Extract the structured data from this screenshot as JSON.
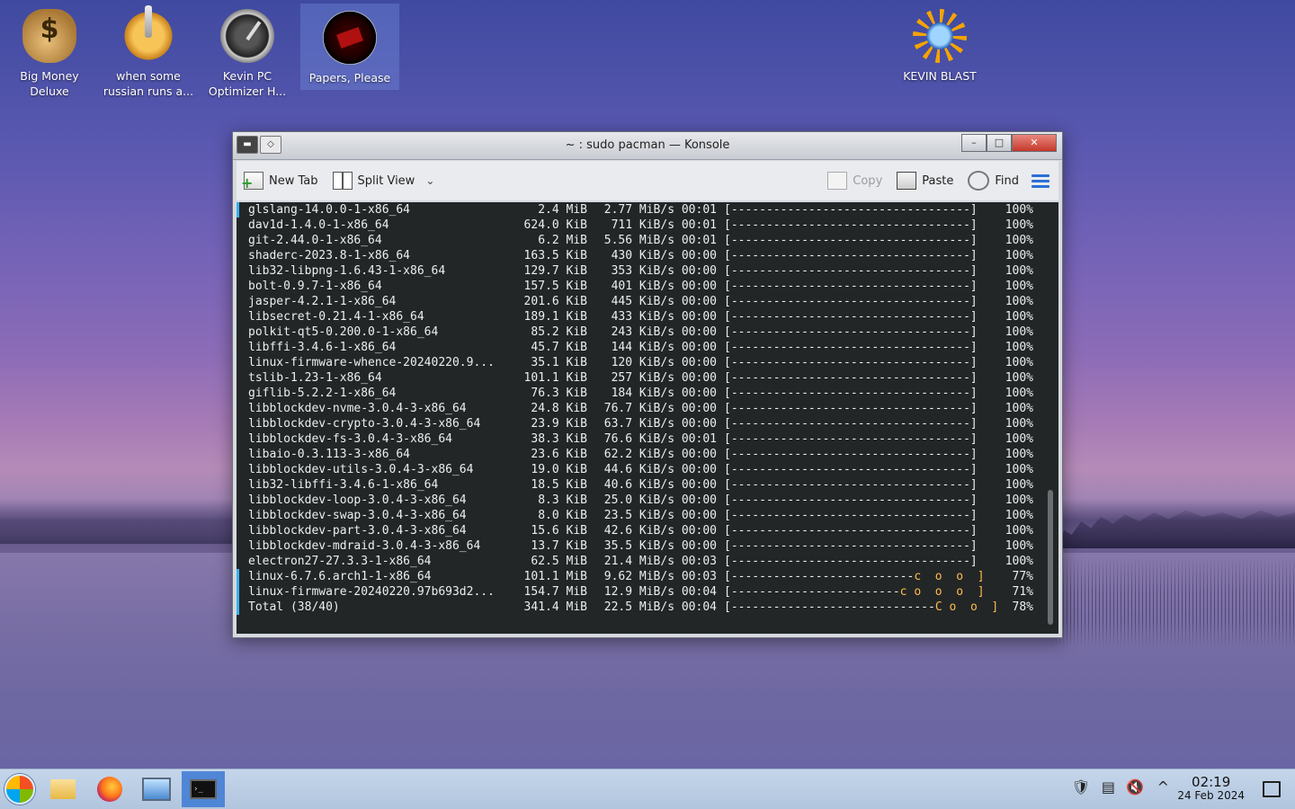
{
  "desktop": {
    "icons": [
      {
        "label1": "Big Money",
        "label2": "Deluxe",
        "icon": "money-bag-icon"
      },
      {
        "label1": "when some",
        "label2": "russian runs a...",
        "icon": "gear-icon"
      },
      {
        "label1": "Kevin PC",
        "label2": "Optimizer H...",
        "icon": "gauge-icon"
      },
      {
        "label1": "Papers, Please",
        "label2": "",
        "icon": "papers-please-icon"
      },
      {
        "label1": "KEVIN BLAST",
        "label2": "",
        "icon": "sun-icon"
      }
    ]
  },
  "window": {
    "title": "~ : sudo pacman — Konsole",
    "toolbar": {
      "new_tab": "New Tab",
      "split_view": "Split View",
      "copy": "Copy",
      "paste": "Paste",
      "find": "Find"
    }
  },
  "terminal": {
    "rows": [
      {
        "name": "glslang-14.0.0-1-x86_64",
        "size": "2.4 MiB",
        "speed": "2.77 MiB/s 00:01",
        "bar": "[----------------------------------]",
        "pac": "",
        "pct": "100%"
      },
      {
        "name": "dav1d-1.4.0-1-x86_64",
        "size": "624.0 KiB",
        "speed": "711 KiB/s 00:01",
        "bar": "[----------------------------------]",
        "pac": "",
        "pct": "100%"
      },
      {
        "name": "git-2.44.0-1-x86_64",
        "size": "6.2 MiB",
        "speed": "5.56 MiB/s 00:01",
        "bar": "[----------------------------------]",
        "pac": "",
        "pct": "100%"
      },
      {
        "name": "shaderc-2023.8-1-x86_64",
        "size": "163.5 KiB",
        "speed": "430 KiB/s 00:00",
        "bar": "[----------------------------------]",
        "pac": "",
        "pct": "100%"
      },
      {
        "name": "lib32-libpng-1.6.43-1-x86_64",
        "size": "129.7 KiB",
        "speed": "353 KiB/s 00:00",
        "bar": "[----------------------------------]",
        "pac": "",
        "pct": "100%"
      },
      {
        "name": "bolt-0.9.7-1-x86_64",
        "size": "157.5 KiB",
        "speed": "401 KiB/s 00:00",
        "bar": "[----------------------------------]",
        "pac": "",
        "pct": "100%"
      },
      {
        "name": "jasper-4.2.1-1-x86_64",
        "size": "201.6 KiB",
        "speed": "445 KiB/s 00:00",
        "bar": "[----------------------------------]",
        "pac": "",
        "pct": "100%"
      },
      {
        "name": "libsecret-0.21.4-1-x86_64",
        "size": "189.1 KiB",
        "speed": "433 KiB/s 00:00",
        "bar": "[----------------------------------]",
        "pac": "",
        "pct": "100%"
      },
      {
        "name": "polkit-qt5-0.200.0-1-x86_64",
        "size": "85.2 KiB",
        "speed": "243 KiB/s 00:00",
        "bar": "[----------------------------------]",
        "pac": "",
        "pct": "100%"
      },
      {
        "name": "libffi-3.4.6-1-x86_64",
        "size": "45.7 KiB",
        "speed": "144 KiB/s 00:00",
        "bar": "[----------------------------------]",
        "pac": "",
        "pct": "100%"
      },
      {
        "name": "linux-firmware-whence-20240220.9...",
        "size": "35.1 KiB",
        "speed": "120 KiB/s 00:00",
        "bar": "[----------------------------------]",
        "pac": "",
        "pct": "100%"
      },
      {
        "name": "tslib-1.23-1-x86_64",
        "size": "101.1 KiB",
        "speed": "257 KiB/s 00:00",
        "bar": "[----------------------------------]",
        "pac": "",
        "pct": "100%"
      },
      {
        "name": "giflib-5.2.2-1-x86_64",
        "size": "76.3 KiB",
        "speed": "184 KiB/s 00:00",
        "bar": "[----------------------------------]",
        "pac": "",
        "pct": "100%"
      },
      {
        "name": "libblockdev-nvme-3.0.4-3-x86_64",
        "size": "24.8 KiB",
        "speed": "76.7 KiB/s 00:00",
        "bar": "[----------------------------------]",
        "pac": "",
        "pct": "100%"
      },
      {
        "name": "libblockdev-crypto-3.0.4-3-x86_64",
        "size": "23.9 KiB",
        "speed": "63.7 KiB/s 00:00",
        "bar": "[----------------------------------]",
        "pac": "",
        "pct": "100%"
      },
      {
        "name": "libblockdev-fs-3.0.4-3-x86_64",
        "size": "38.3 KiB",
        "speed": "76.6 KiB/s 00:01",
        "bar": "[----------------------------------]",
        "pac": "",
        "pct": "100%"
      },
      {
        "name": "libaio-0.3.113-3-x86_64",
        "size": "23.6 KiB",
        "speed": "62.2 KiB/s 00:00",
        "bar": "[----------------------------------]",
        "pac": "",
        "pct": "100%"
      },
      {
        "name": "libblockdev-utils-3.0.4-3-x86_64",
        "size": "19.0 KiB",
        "speed": "44.6 KiB/s 00:00",
        "bar": "[----------------------------------]",
        "pac": "",
        "pct": "100%"
      },
      {
        "name": "lib32-libffi-3.4.6-1-x86_64",
        "size": "18.5 KiB",
        "speed": "40.6 KiB/s 00:00",
        "bar": "[----------------------------------]",
        "pac": "",
        "pct": "100%"
      },
      {
        "name": "libblockdev-loop-3.0.4-3-x86_64",
        "size": "8.3 KiB",
        "speed": "25.0 KiB/s 00:00",
        "bar": "[----------------------------------]",
        "pac": "",
        "pct": "100%"
      },
      {
        "name": "libblockdev-swap-3.0.4-3-x86_64",
        "size": "8.0 KiB",
        "speed": "23.5 KiB/s 00:00",
        "bar": "[----------------------------------]",
        "pac": "",
        "pct": "100%"
      },
      {
        "name": "libblockdev-part-3.0.4-3-x86_64",
        "size": "15.6 KiB",
        "speed": "42.6 KiB/s 00:00",
        "bar": "[----------------------------------]",
        "pac": "",
        "pct": "100%"
      },
      {
        "name": "libblockdev-mdraid-3.0.4-3-x86_64",
        "size": "13.7 KiB",
        "speed": "35.5 KiB/s 00:00",
        "bar": "[----------------------------------]",
        "pac": "",
        "pct": "100%"
      },
      {
        "name": "electron27-27.3.3-1-x86_64",
        "size": "62.5 MiB",
        "speed": "21.4 MiB/s 00:03",
        "bar": "[----------------------------------]",
        "pac": "",
        "pct": "100%"
      },
      {
        "name": "linux-6.7.6.arch1-1-x86_64",
        "size": "101.1 MiB",
        "speed": "9.62 MiB/s 00:03",
        "bar": "[--------------------------",
        "pac": "c  o  o  ]",
        "pct": "77%"
      },
      {
        "name": "linux-firmware-20240220.97b693d2...",
        "size": "154.7 MiB",
        "speed": "12.9 MiB/s 00:04",
        "bar": "[------------------------",
        "pac": "c o  o  o  ]",
        "pct": "71%"
      },
      {
        "name": "Total (38/40)",
        "size": "341.4 MiB",
        "speed": "22.5 MiB/s 00:04",
        "bar": "[-----------------------------",
        "pac": "C o  o  ]",
        "pct": "78%"
      }
    ]
  },
  "taskbar": {
    "clock_time": "02:19",
    "clock_date": "24 Feb 2024"
  },
  "colors": {
    "terminal_bg": "#232627",
    "terminal_fg": "#eceff0",
    "pacman": "#fdbc4b",
    "accent": "#3daee9",
    "taskbar_active": "#4f86d6"
  }
}
